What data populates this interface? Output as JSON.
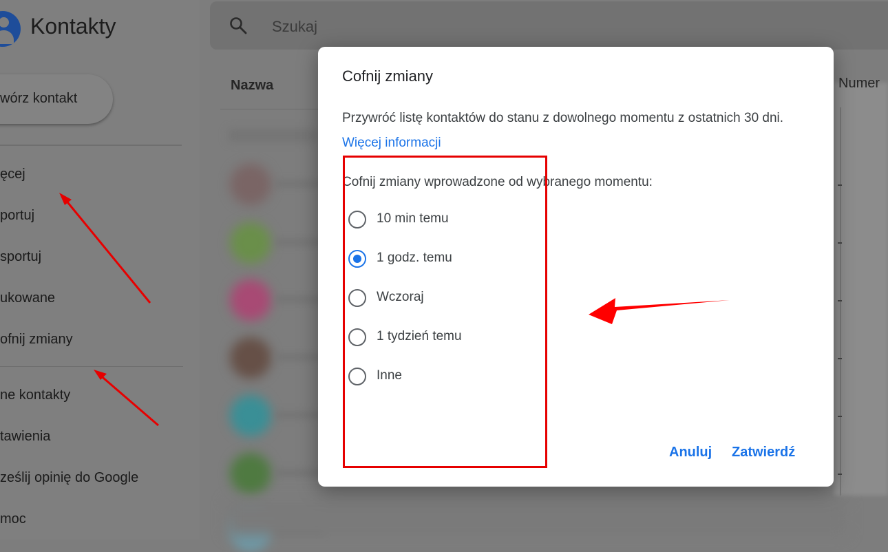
{
  "app": {
    "title": "Kontakty",
    "create_label": "wórz kontakt",
    "menu": [
      "ęcej",
      "portuj",
      "sportuj",
      "ukowane",
      "ofnij zmiany"
    ],
    "menu2": [
      "ne kontakty",
      "tawienia",
      "ześlij opinię do Google",
      "moc"
    ]
  },
  "search": {
    "placeholder": "Szukaj"
  },
  "list": {
    "header_name": "Nazwa",
    "header_phone": "Numer"
  },
  "dialog": {
    "title": "Cofnij zmiany",
    "description": "Przywróć listę kontaktów do stanu z dowolnego momentu z ostatnich 30 dni.",
    "link": "Więcej informacji",
    "subtitle": "Cofnij zmiany wprowadzone od wybranego momentu:",
    "options": [
      "10 min temu",
      "1 godz. temu",
      "Wczoraj",
      "1 tydzień temu",
      "Inne"
    ],
    "selected_option": "1 godz. temu",
    "cancel": "Anuluj",
    "confirm": "Zatwierdź"
  },
  "colors": {
    "accent": "#1a73e8",
    "annotation": "#e60000",
    "avatars": [
      "#7a6565",
      "#6a8f4a",
      "#a84a74",
      "#665047",
      "#3a8f96",
      "#4f7a41",
      "#6e9aa8"
    ]
  }
}
